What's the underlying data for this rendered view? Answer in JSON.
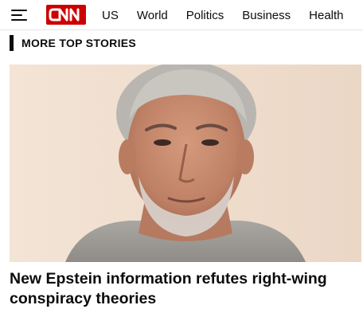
{
  "header": {
    "logo_text": "CNN",
    "nav": [
      "US",
      "World",
      "Politics",
      "Business",
      "Health"
    ]
  },
  "section": {
    "title": "MORE TOP STORIES"
  },
  "story": {
    "headline": "New Epstein information refutes right-wing conspiracy theories"
  },
  "colors": {
    "brand_red": "#cc0000",
    "text": "#0c0c0c"
  },
  "icons": [
    "menu-icon",
    "cnn-logo"
  ]
}
